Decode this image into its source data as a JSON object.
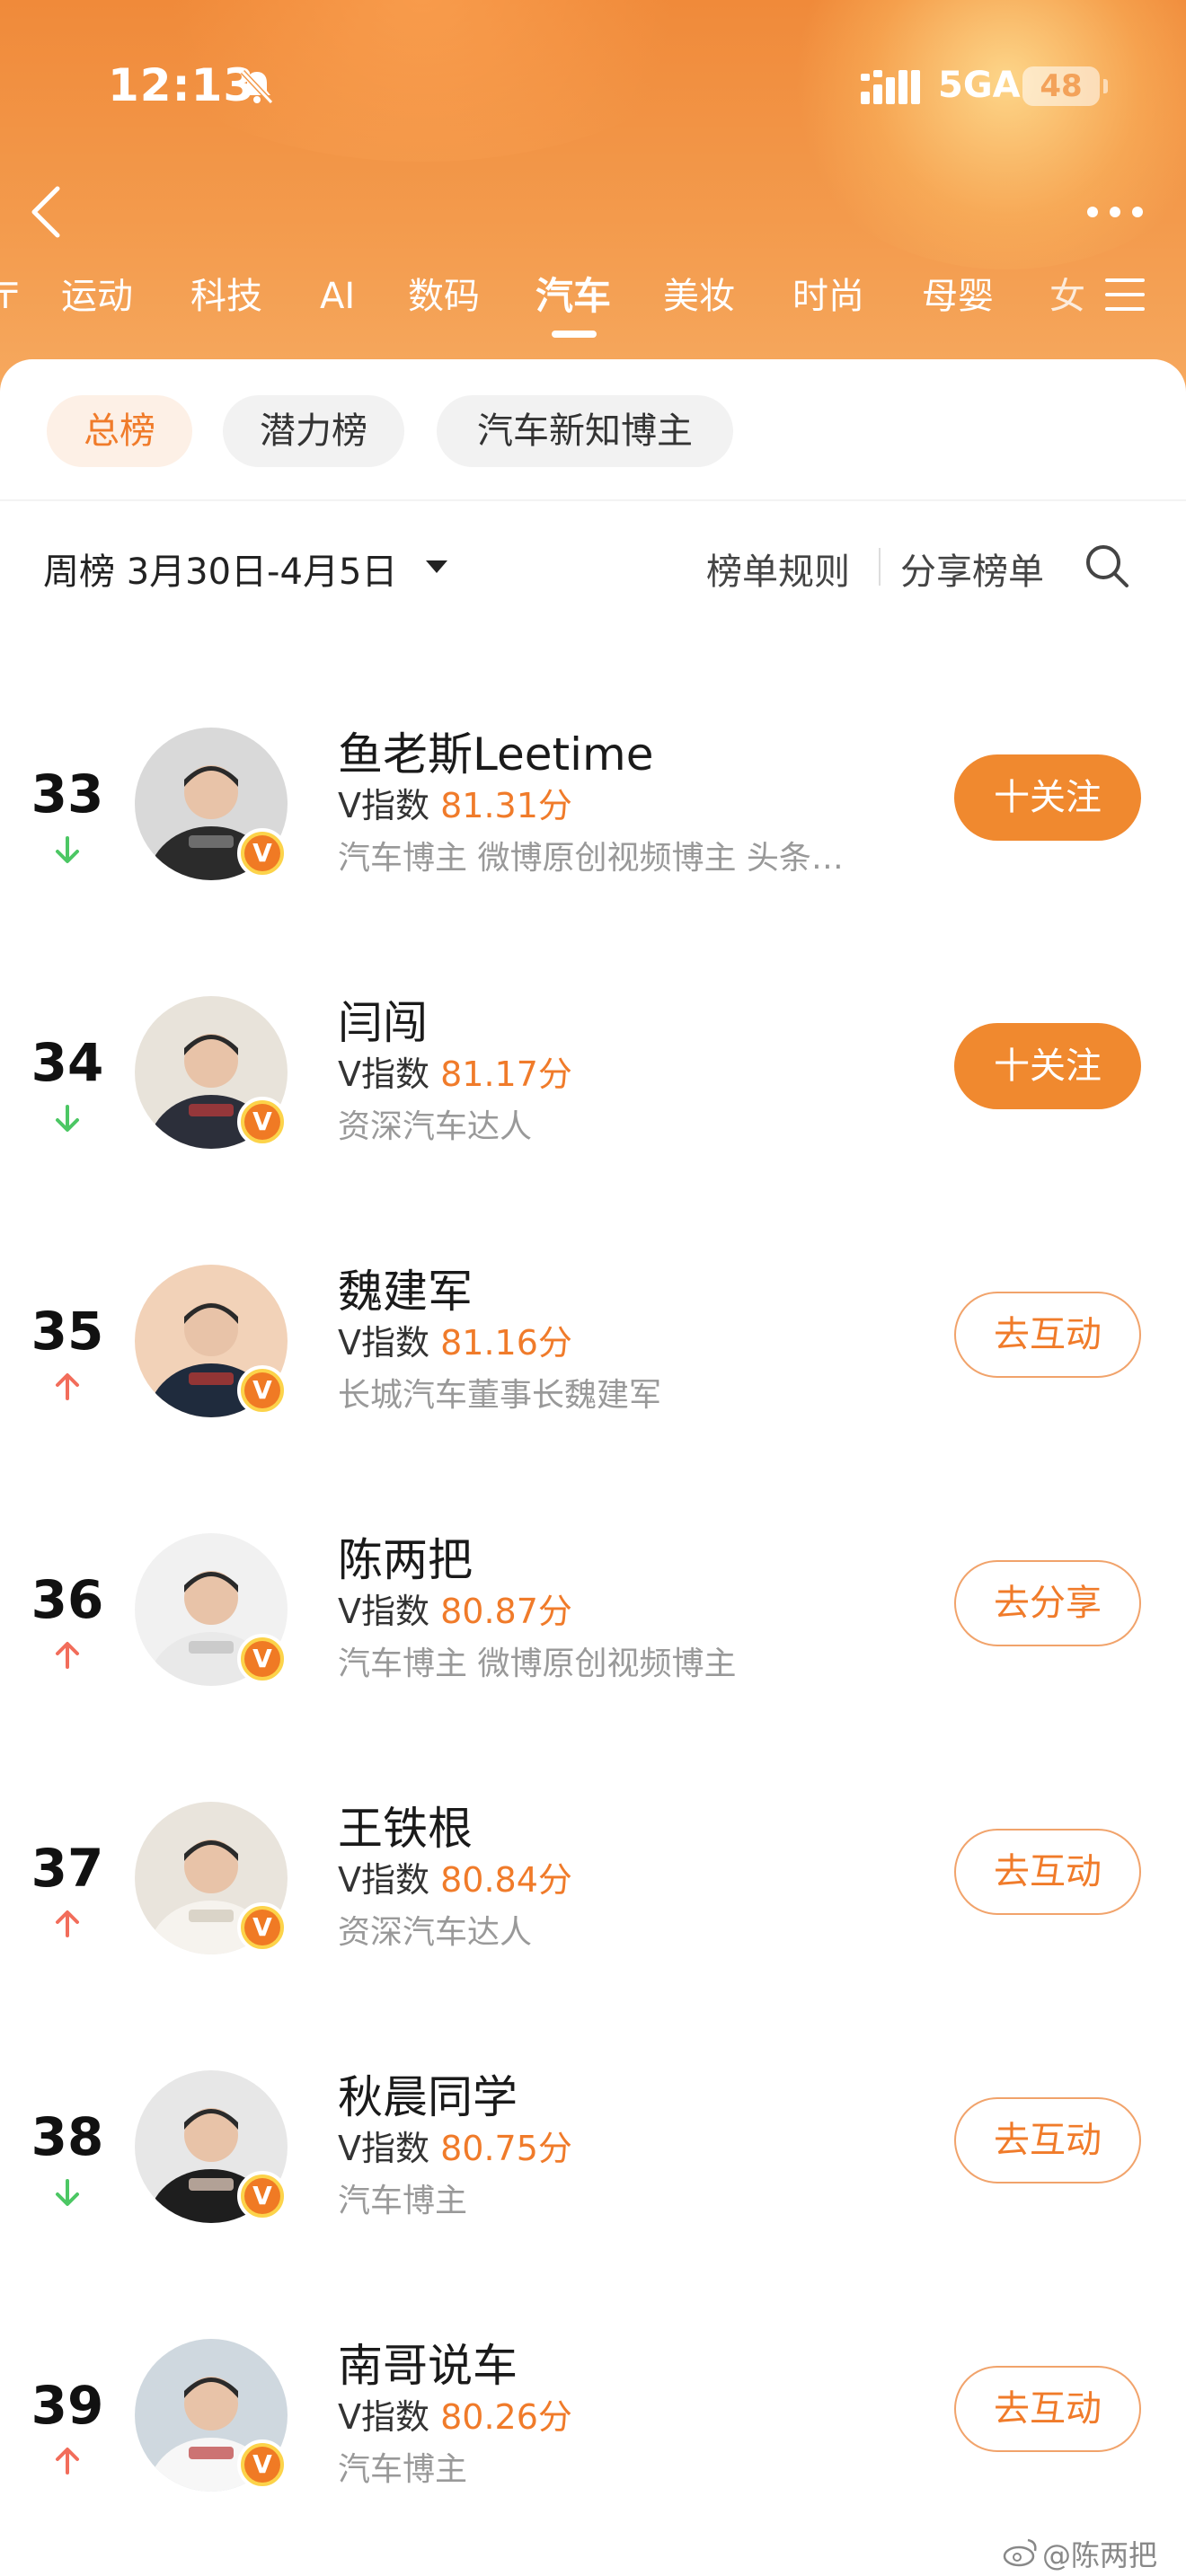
{
  "status_bar": {
    "time": "12:13",
    "network": "5GA",
    "battery": "48"
  },
  "category_tabs": [
    {
      "label": "运动"
    },
    {
      "label": "科技"
    },
    {
      "label": "AI"
    },
    {
      "label": "数码"
    },
    {
      "label": "汽车",
      "active": true
    },
    {
      "label": "美妆"
    },
    {
      "label": "时尚"
    },
    {
      "label": "母婴"
    }
  ],
  "sub_tabs": [
    {
      "label": "总榜",
      "active": true
    },
    {
      "label": "潜力榜"
    },
    {
      "label": "汽车新知博主"
    }
  ],
  "filter": {
    "week_label": "周榜 3月30日-4月5日",
    "rules": "榜单规则",
    "share": "分享榜单"
  },
  "colors": {
    "accent": "#f07b2a",
    "trend_up": "#f26d5b",
    "trend_down": "#4cc764"
  },
  "ranking": [
    {
      "rank": "33",
      "trend": "down",
      "name": "鱼老斯Leetime",
      "v_prefix": "V指数",
      "score": "81.31分",
      "desc": "汽车博主 微博原创视频博主 头条…",
      "action": "十关注",
      "action_style": "follow"
    },
    {
      "rank": "34",
      "trend": "down",
      "name": "闫闯",
      "v_prefix": "V指数",
      "score": "81.17分",
      "desc": "资深汽车达人",
      "action": "十关注",
      "action_style": "follow"
    },
    {
      "rank": "35",
      "trend": "up",
      "name": "魏建军",
      "v_prefix": "V指数",
      "score": "81.16分",
      "desc": "长城汽车董事长魏建军",
      "action": "去互动",
      "action_style": "outline"
    },
    {
      "rank": "36",
      "trend": "up",
      "name": "陈两把",
      "v_prefix": "V指数",
      "score": "80.87分",
      "desc": "汽车博主 微博原创视频博主",
      "action": "去分享",
      "action_style": "outline"
    },
    {
      "rank": "37",
      "trend": "up",
      "name": "王铁根",
      "v_prefix": "V指数",
      "score": "80.84分",
      "desc": "资深汽车达人",
      "action": "去互动",
      "action_style": "outline"
    },
    {
      "rank": "38",
      "trend": "down",
      "name": "秋晨同学",
      "v_prefix": "V指数",
      "score": "80.75分",
      "desc": "汽车博主",
      "action": "去互动",
      "action_style": "outline"
    },
    {
      "rank": "39",
      "trend": "up",
      "name": "南哥说车",
      "v_prefix": "V指数",
      "score": "80.26分",
      "desc": "汽车博主",
      "action": "去互动",
      "action_style": "outline"
    }
  ],
  "watermark": "@陈两把"
}
